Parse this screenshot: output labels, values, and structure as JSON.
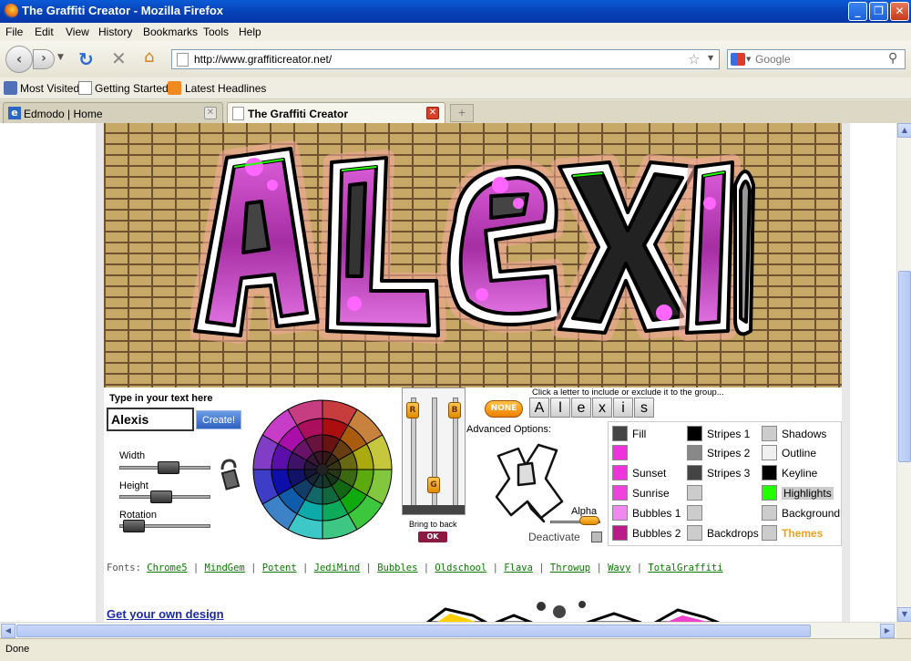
{
  "window": {
    "title": "The Graffiti Creator - Mozilla Firefox"
  },
  "menu": [
    "File",
    "Edit",
    "View",
    "History",
    "Bookmarks",
    "Tools",
    "Help"
  ],
  "nav": {
    "url": "http://www.graffiticreator.net/",
    "search_placeholder": "Google"
  },
  "bookmarks": [
    "Most Visited",
    "Getting Started",
    "Latest Headlines"
  ],
  "tabs": [
    {
      "label": "Edmodo | Home",
      "active": false
    },
    {
      "label": "The Graffiti Creator",
      "active": true
    }
  ],
  "graffiti": {
    "text": "ALEXIS",
    "fill_color": "#b23ab0",
    "highlight_color": "#22ff00"
  },
  "controls": {
    "type_label": "Type in your text here",
    "text_value": "Alexis",
    "create_label": "Create!",
    "width_label": "Width",
    "width_value": 0.55,
    "height_label": "Height",
    "height_value": 0.45,
    "rotation_label": "Rotation",
    "rotation_value": 0.05,
    "r_label": "R",
    "b_label": "B",
    "g_label": "G",
    "r_value": 0.95,
    "b_value": 0.95,
    "g_value": 0.15,
    "bring_to_back_label": "Bring to back",
    "ok_label": "OK",
    "letters_hint": "Click a letter to include or exclude it to the group...",
    "none_label": "NONE",
    "letters": [
      "A",
      "l",
      "e",
      "x",
      "i",
      "s"
    ],
    "advanced_label": "Advanced Options:",
    "alpha_label": "Alpha",
    "deactivate_label": "Deactivate"
  },
  "layers": [
    {
      "label": "Fill",
      "color": "#444444"
    },
    {
      "label": "Stripes 1",
      "color": "#000000"
    },
    {
      "label": "Shadows",
      "color": "#cccccc"
    },
    {
      "label": "",
      "color": "#ee33dd"
    },
    {
      "label": "Stripes 2",
      "color": "#888888"
    },
    {
      "label": "Outline",
      "color": "#f0f0f0"
    },
    {
      "label": "Sunset",
      "color": "#ee33dd"
    },
    {
      "label": "Stripes 3",
      "color": "#444444"
    },
    {
      "label": "Keyline",
      "color": "#000000"
    },
    {
      "label": "Sunrise",
      "color": "#ee44dd"
    },
    {
      "label": "",
      "color": "#cccccc"
    },
    {
      "label": "Highlights",
      "color": "#22ff00"
    },
    {
      "label": "Bubbles 1",
      "color": "#f088f0"
    },
    {
      "label": "",
      "color": "#cccccc"
    },
    {
      "label": "Background",
      "color": "#cccccc"
    },
    {
      "label": "Bubbles 2",
      "color": "#bb1a88"
    },
    {
      "label": "Backdrops",
      "color": "#cccccc"
    },
    {
      "label": "Themes",
      "color": "#cccccc"
    }
  ],
  "fonts": {
    "label": "Fonts:",
    "items": [
      "Chrome5",
      "MindGem",
      "Potent",
      "JediMind",
      "Bubbles",
      "Oldschool",
      "Flava",
      "Throwup",
      "Wavy",
      "TotalGraffiti"
    ]
  },
  "get_design_label": "Get your own design",
  "status": "Done"
}
